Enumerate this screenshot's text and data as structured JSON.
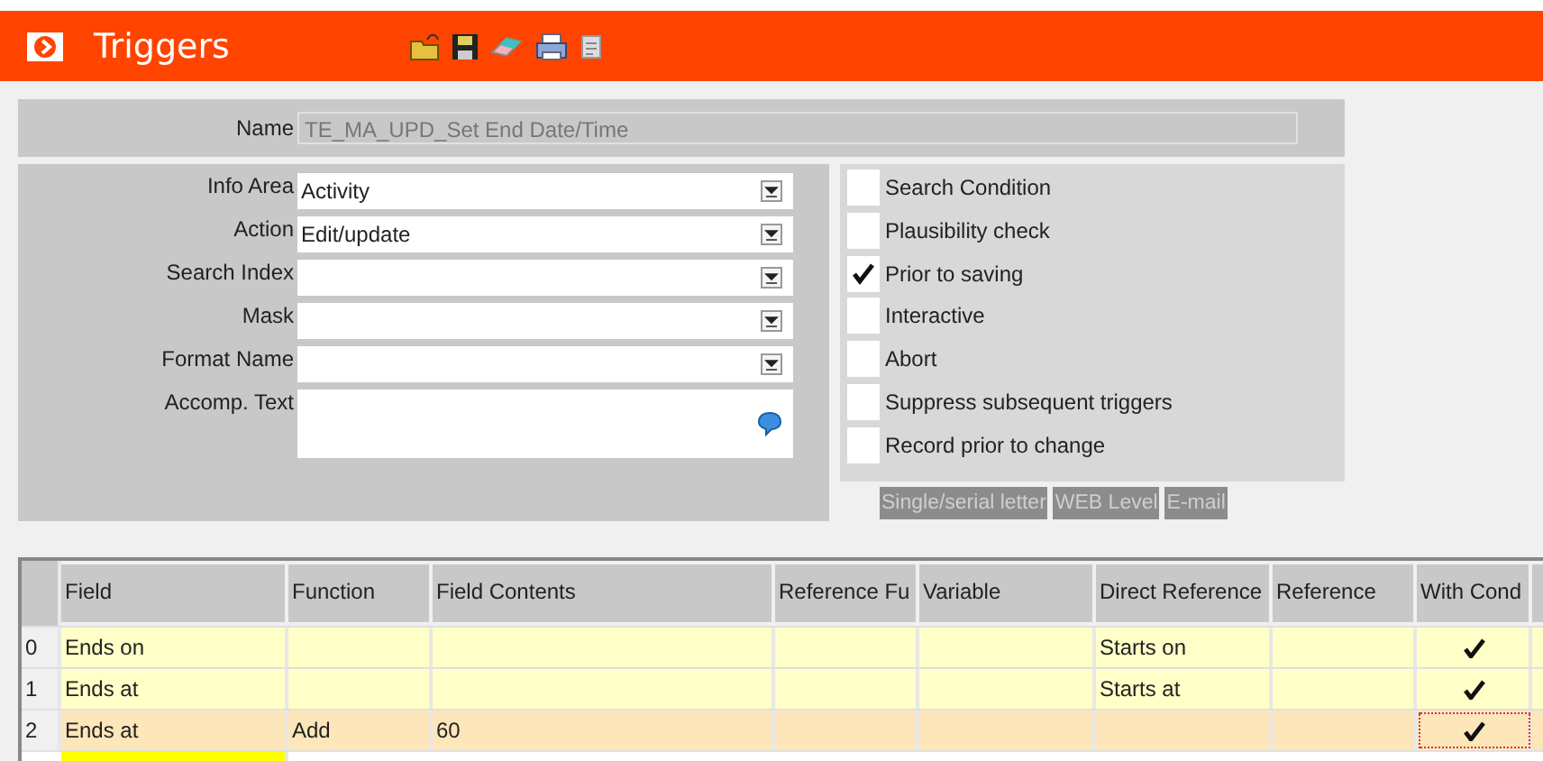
{
  "window": {
    "title": "Triggers"
  },
  "name_field": {
    "label": "Name",
    "value": "TE_MA_UPD_Set End Date/Time",
    "disabled": true
  },
  "form_fields": [
    {
      "label": "Info Area",
      "value": "Activity",
      "kind": "dropdown"
    },
    {
      "label": "Action",
      "value": "Edit/update",
      "kind": "dropdown"
    },
    {
      "label": "Search Index",
      "kind": "dropdown"
    },
    {
      "label": "Mask",
      "kind": "dropdown"
    },
    {
      "label": "Format Name",
      "kind": "dropdown"
    },
    {
      "label": "Accomp. Text",
      "kind": "textarea"
    }
  ],
  "options": [
    {
      "label": "Search Condition",
      "checked": false
    },
    {
      "label": "Plausibility check",
      "checked": false
    },
    {
      "label": "Prior to saving",
      "checked": true
    },
    {
      "label": "Interactive",
      "checked": false
    },
    {
      "label": "Abort",
      "checked": false
    },
    {
      "label": "Suppress subsequent triggers",
      "checked": false
    },
    {
      "label": "Record prior to change",
      "checked": false
    }
  ],
  "buttons": [
    {
      "label": "Single/serial letter",
      "disabled": true
    },
    {
      "label": "WEB Level",
      "disabled": true
    },
    {
      "label": "E-mail",
      "disabled": true
    }
  ],
  "table": {
    "columns": [
      "Field",
      "Function",
      "Field Contents",
      "Reference Fu",
      "Variable",
      "Direct Reference",
      "Reference",
      "With Cond"
    ],
    "rows": [
      {
        "index": "0",
        "field": "Ends on",
        "direct_reference": "Starts on",
        "with_condition": true,
        "selected": false
      },
      {
        "index": "1",
        "field": "Ends at",
        "direct_reference": "Starts at",
        "with_condition": true,
        "selected": false
      },
      {
        "index": "2",
        "field": "Ends at",
        "function": "Add",
        "field_contents": "60",
        "with_condition": true,
        "selected": true
      }
    ]
  }
}
